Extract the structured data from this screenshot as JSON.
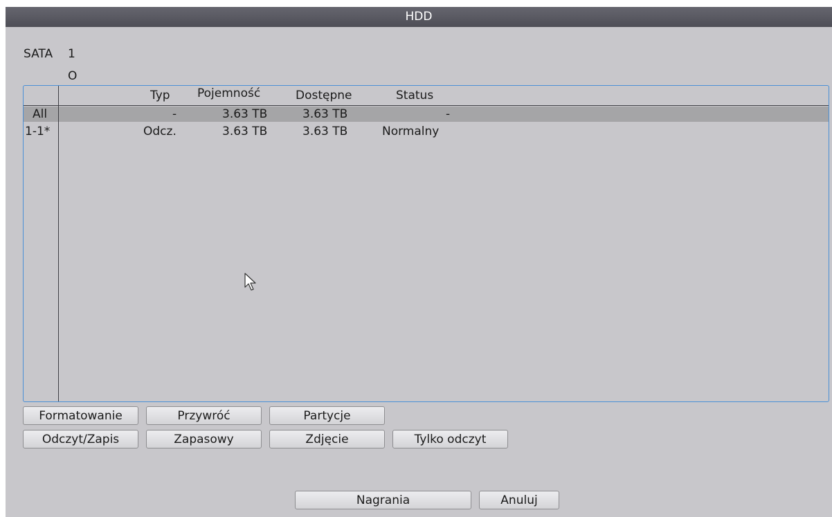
{
  "window": {
    "title": "HDD"
  },
  "sata": {
    "label": "SATA",
    "number": "1",
    "status_symbol": "O"
  },
  "table": {
    "columns": [
      "Typ",
      "Pojemność",
      "Dostępne",
      "Status"
    ],
    "rows": [
      {
        "id": "All",
        "typ": "-",
        "pojemnosc": "3.63 TB",
        "dostepne": "3.63 TB",
        "status": "-"
      },
      {
        "id": "1-1*",
        "typ": "Odcz.",
        "pojemnosc": "3.63 TB",
        "dostepne": "3.63 TB",
        "status": "Normalny"
      }
    ]
  },
  "buttons": {
    "format": "Formatowanie",
    "restore": "Przywróć",
    "partitions": "Partycje",
    "read_write": "Odczyt/Zapis",
    "backup": "Zapasowy",
    "snapshot": "Zdjęcie",
    "read_only": "Tylko odczyt",
    "recordings": "Nagrania",
    "cancel": "Anuluj"
  }
}
